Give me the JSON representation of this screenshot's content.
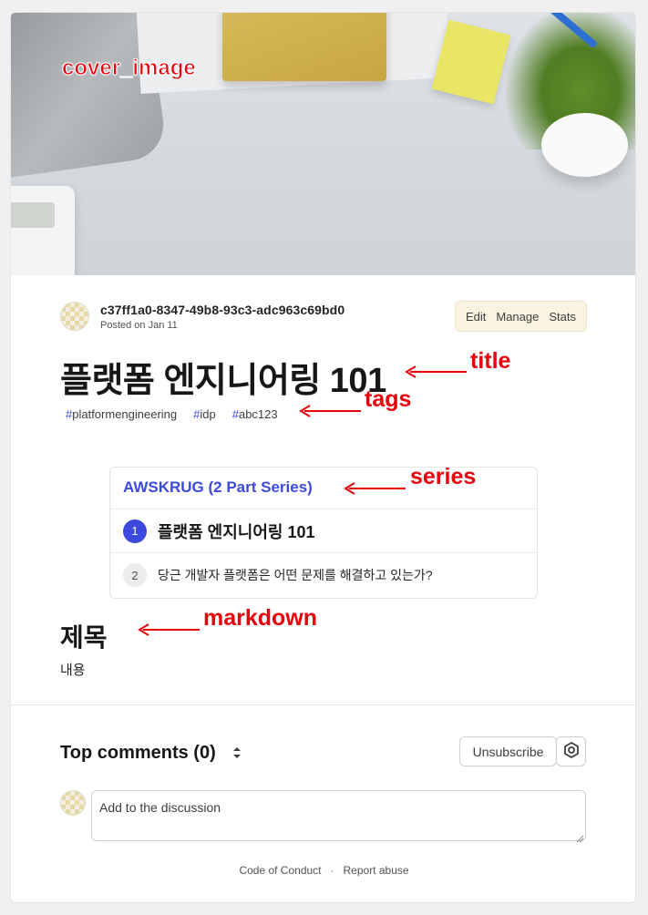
{
  "cover": {
    "annotation": "cover_image"
  },
  "author": {
    "name": "c37ff1a0-8347-49b8-93c3-adc963c69bd0",
    "posted": "Posted on Jan 11"
  },
  "actions": {
    "edit": "Edit",
    "manage": "Manage",
    "stats": "Stats"
  },
  "article": {
    "title": "플랫폼 엔지니어링 101",
    "tags": [
      {
        "hash": "#",
        "name": "platformengineering"
      },
      {
        "hash": "#",
        "name": "idp"
      },
      {
        "hash": "#",
        "name": "abc123"
      }
    ]
  },
  "series": {
    "heading": "AWSKRUG (2 Part Series)",
    "items": [
      {
        "num": "1",
        "label": "플랫폼 엔지니어링 101"
      },
      {
        "num": "2",
        "label": "당근 개발자 플랫폼은 어떤 문제를 해결하고 있는가?"
      }
    ]
  },
  "markdown": {
    "heading": "제목",
    "body": "내용"
  },
  "comments": {
    "title": "Top comments (0)",
    "unsubscribe": "Unsubscribe",
    "placeholder": "Add to the discussion"
  },
  "footer": {
    "conduct": "Code of Conduct",
    "separator": "·",
    "report": "Report abuse"
  },
  "annotations": {
    "title": "title",
    "tags": "tags",
    "series": "series",
    "markdown": "markdown"
  },
  "colors": {
    "accent": "#3b49df",
    "annotation": "#e8000b",
    "actions_bg": "#fbf3e1"
  },
  "icons": {
    "sort": "sort-updown-icon",
    "settings": "gear-hexagon-icon"
  }
}
